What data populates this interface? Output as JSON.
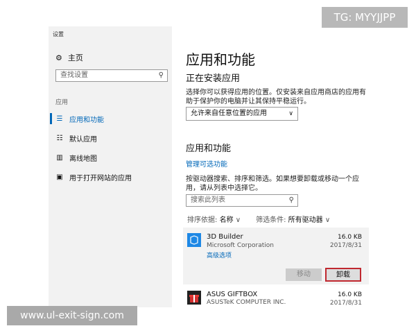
{
  "window": {
    "title": "设置"
  },
  "sidebar": {
    "home": "主页",
    "search_placeholder": "查找设置",
    "section": "应用",
    "items": [
      {
        "label": "应用和功能",
        "icon": "list-icon",
        "active": true
      },
      {
        "label": "默认应用",
        "icon": "default-apps-icon"
      },
      {
        "label": "离线地图",
        "icon": "map-icon"
      },
      {
        "label": "用于打开网站的应用",
        "icon": "website-apps-icon"
      }
    ]
  },
  "main": {
    "title": "应用和功能",
    "install_heading": "正在安装应用",
    "install_desc": "选择你可以获得应用的位置。仅安装来自应用商店的应用有助于保护你的电脑并让其保持平稳运行。",
    "install_select": "允许来自任意位置的应用",
    "apps_heading": "应用和功能",
    "manage_link": "管理可选功能",
    "apps_desc": "按驱动器搜索、排序和筛选。如果想要卸载或移动一个应用，请从列表中选择它。",
    "search_placeholder": "搜索此列表",
    "sort_label": "排序依据:",
    "sort_value": "名称",
    "filter_label": "筛选条件:",
    "filter_value": "所有驱动器",
    "apps": [
      {
        "name": "3D Builder",
        "publisher": "Microsoft Corporation",
        "size": "16.0 KB",
        "date": "2017/8/31",
        "advanced": "高级选项"
      },
      {
        "name": "ASUS GIFTBOX",
        "publisher": "ASUSTeK COMPUTER INC.",
        "size": "16.0 KB",
        "date": "2017/8/31"
      }
    ],
    "move_button": "移动",
    "uninstall_button": "卸载"
  },
  "watermarks": {
    "top": "TG: MYYJJPP",
    "bottom": "www.ul-exit-sign.com"
  },
  "colors": {
    "accent": "#0067b8",
    "highlight": "#c0282f"
  }
}
